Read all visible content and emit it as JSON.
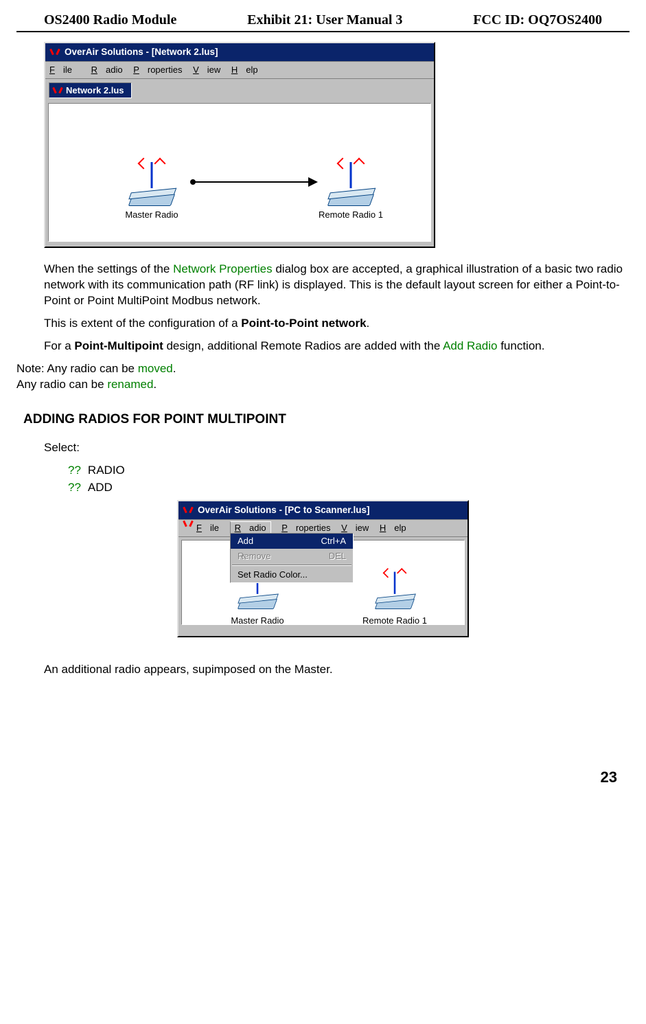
{
  "header": {
    "left": "OS2400 Radio Module",
    "center": "Exhibit 21: User Manual 3",
    "right": "FCC ID: OQ7OS2400"
  },
  "window1": {
    "title": "OverAir Solutions - [Network 2.lus]",
    "menu": {
      "file": "File",
      "radio": "Radio",
      "properties": "Properties",
      "view": "View",
      "help": "Help"
    },
    "tab": "Network 2.lus",
    "master_label": "Master Radio",
    "remote_label": "Remote Radio 1"
  },
  "para1_a": "When the settings of the ",
  "para1_link": "Network Properties",
  "para1_b": " dialog box are accepted, a graphical illustration of a basic two radio network with its communication path (RF link) is displayed.  This is the default layout screen for either a Point-to-Point or Point MultiPoint Modbus network.",
  "para2_a": "This is extent of the configuration of a ",
  "para2_b": "Point-to-Point network",
  "para2_c": ".",
  "para3_a": "For a ",
  "para3_b": "Point-Multipoint",
  "para3_c": " design, additional Remote Radios are added with the ",
  "para3_link": "Add Radio",
  "para3_d": " function.",
  "note_a": "Note:  Any radio can be ",
  "note_link1": "moved",
  "note_b": ".",
  "note2_a": "Any radio can be ",
  "note2_link": "renamed",
  "note2_b": ".",
  "section_heading": "ADDING RADIOS FOR POINT MULTIPOINT",
  "select_label": "Select:",
  "list": {
    "qq": "??",
    "item1": "RADIO",
    "item2": "ADD"
  },
  "window2": {
    "title": "OverAir Solutions - [PC to Scanner.lus]",
    "menu": {
      "file": "File",
      "radio": "Radio",
      "properties": "Properties",
      "view": "View",
      "help": "Help"
    },
    "dropdown": {
      "add": "Add",
      "add_sc": "Ctrl+A",
      "remove": "Remove",
      "remove_sc": "DEL",
      "set_color": "Set Radio Color..."
    },
    "master_label": "Master Radio",
    "remote_label": "Remote Radio 1"
  },
  "closing": "An additional radio appears, supimposed on the Master.",
  "page_number": "23"
}
